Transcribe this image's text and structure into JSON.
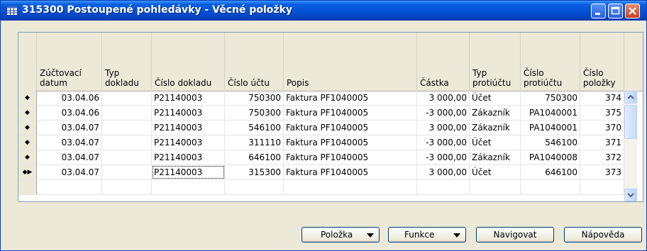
{
  "window": {
    "title": "315300 Postoupené pohledávky - Věcné položky"
  },
  "columns": [
    {
      "key": "date",
      "label": "Zúčtovací\ndatum"
    },
    {
      "key": "doc_type",
      "label": "Typ\ndokladu"
    },
    {
      "key": "doc_no",
      "label": "Číslo dokladu"
    },
    {
      "key": "account",
      "label": "Číslo účtu"
    },
    {
      "key": "desc",
      "label": "Popis"
    },
    {
      "key": "amount",
      "label": "Částka"
    },
    {
      "key": "bal_type",
      "label": "Typ\nprotiúčtu"
    },
    {
      "key": "bal_acc",
      "label": "Číslo\nprotiúčtu"
    },
    {
      "key": "entry_no",
      "label": "Číslo\npoložky"
    }
  ],
  "rows": [
    {
      "marker": "◆",
      "date": "03.04.06",
      "doc_type": "",
      "doc_no": "P21140003",
      "account": "750300",
      "desc": "Faktura PF1040005",
      "amount": "3 000,00",
      "bal_type": "Účet",
      "bal_acc": "750300",
      "entry_no": "374"
    },
    {
      "marker": "◆",
      "date": "03.04.06",
      "doc_type": "",
      "doc_no": "P21140003",
      "account": "750300",
      "desc": "Faktura PF1040005",
      "amount": "-3 000,00",
      "bal_type": "Zákazník",
      "bal_acc": "PA1040001",
      "entry_no": "375"
    },
    {
      "marker": "◆",
      "date": "03.04.07",
      "doc_type": "",
      "doc_no": "P21140003",
      "account": "546100",
      "desc": "Faktura PF1040005",
      "amount": "3 000,00",
      "bal_type": "Zákazník",
      "bal_acc": "PA1040001",
      "entry_no": "370"
    },
    {
      "marker": "◆",
      "date": "03.04.07",
      "doc_type": "",
      "doc_no": "P21140003",
      "account": "311110",
      "desc": "Faktura PF1040005",
      "amount": "-3 000,00",
      "bal_type": "Účet",
      "bal_acc": "546100",
      "entry_no": "371"
    },
    {
      "marker": "◆",
      "date": "03.04.07",
      "doc_type": "",
      "doc_no": "P21140003",
      "account": "646100",
      "desc": "Faktura PF1040005",
      "amount": "-3 000,00",
      "bal_type": "Zákazník",
      "bal_acc": "PA1040008",
      "entry_no": "372"
    },
    {
      "marker": "◆▶",
      "date": "03.04.07",
      "doc_type": "",
      "doc_no": "P21140003",
      "account": "315300",
      "desc": "Faktura PF1040005",
      "amount": "3 000,00",
      "bal_type": "Účet",
      "bal_acc": "646100",
      "entry_no": "373"
    }
  ],
  "buttons": {
    "polozka": "Položka",
    "funkce": "Funkce",
    "navigovat": "Navigovat",
    "napoveda": "Nápověda"
  }
}
